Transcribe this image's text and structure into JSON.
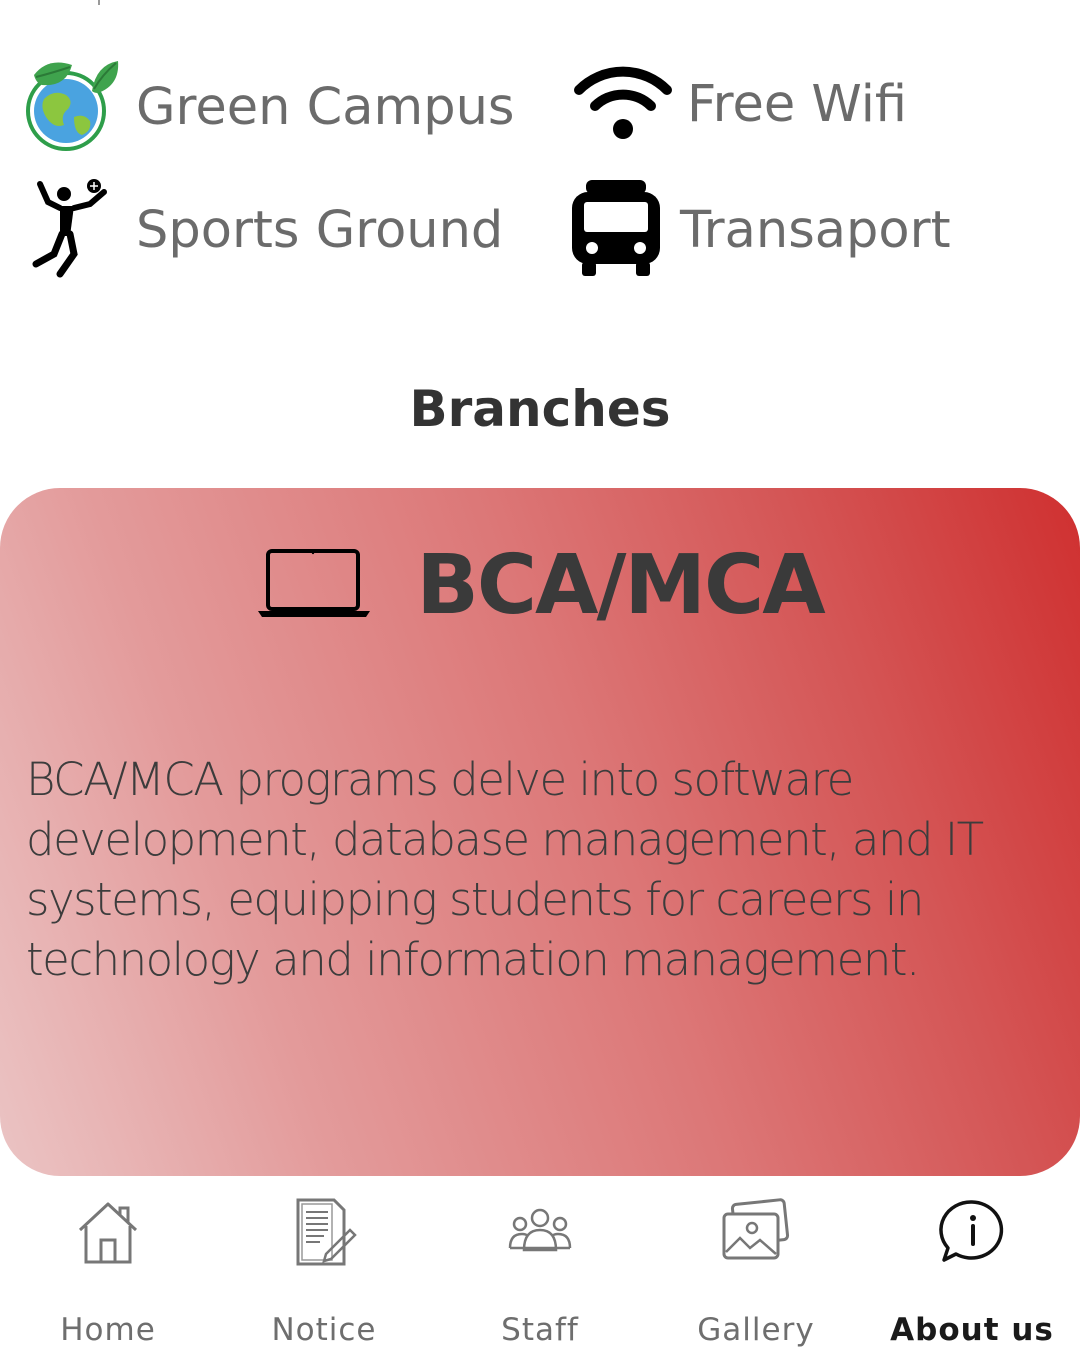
{
  "facilities": [
    {
      "label": "Green Campus",
      "icon": "globe-leaf-icon"
    },
    {
      "label": "Free Wifi",
      "icon": "wifi-icon"
    },
    {
      "label": "Sports Ground",
      "icon": "volleyball-player-icon"
    },
    {
      "label": "Transaport",
      "icon": "bus-icon"
    }
  ],
  "branches": {
    "title": "Branches",
    "card": {
      "icon": "laptop-icon",
      "name": "BCA/MCA",
      "description": "BCA/MCA programs delve into software development, database management, and IT systems, equipping students for careers in technology and information management.",
      "gradient_start": "#ebc4c4",
      "gradient_end": "#cf3030"
    }
  },
  "bottom_nav": {
    "active": "About us",
    "items": [
      {
        "label": "Home",
        "icon": "home-icon"
      },
      {
        "label": "Notice",
        "icon": "notice-icon"
      },
      {
        "label": "Staff",
        "icon": "staff-icon"
      },
      {
        "label": "Gallery",
        "icon": "gallery-icon"
      },
      {
        "label": "About us",
        "icon": "info-chat-icon"
      }
    ]
  }
}
